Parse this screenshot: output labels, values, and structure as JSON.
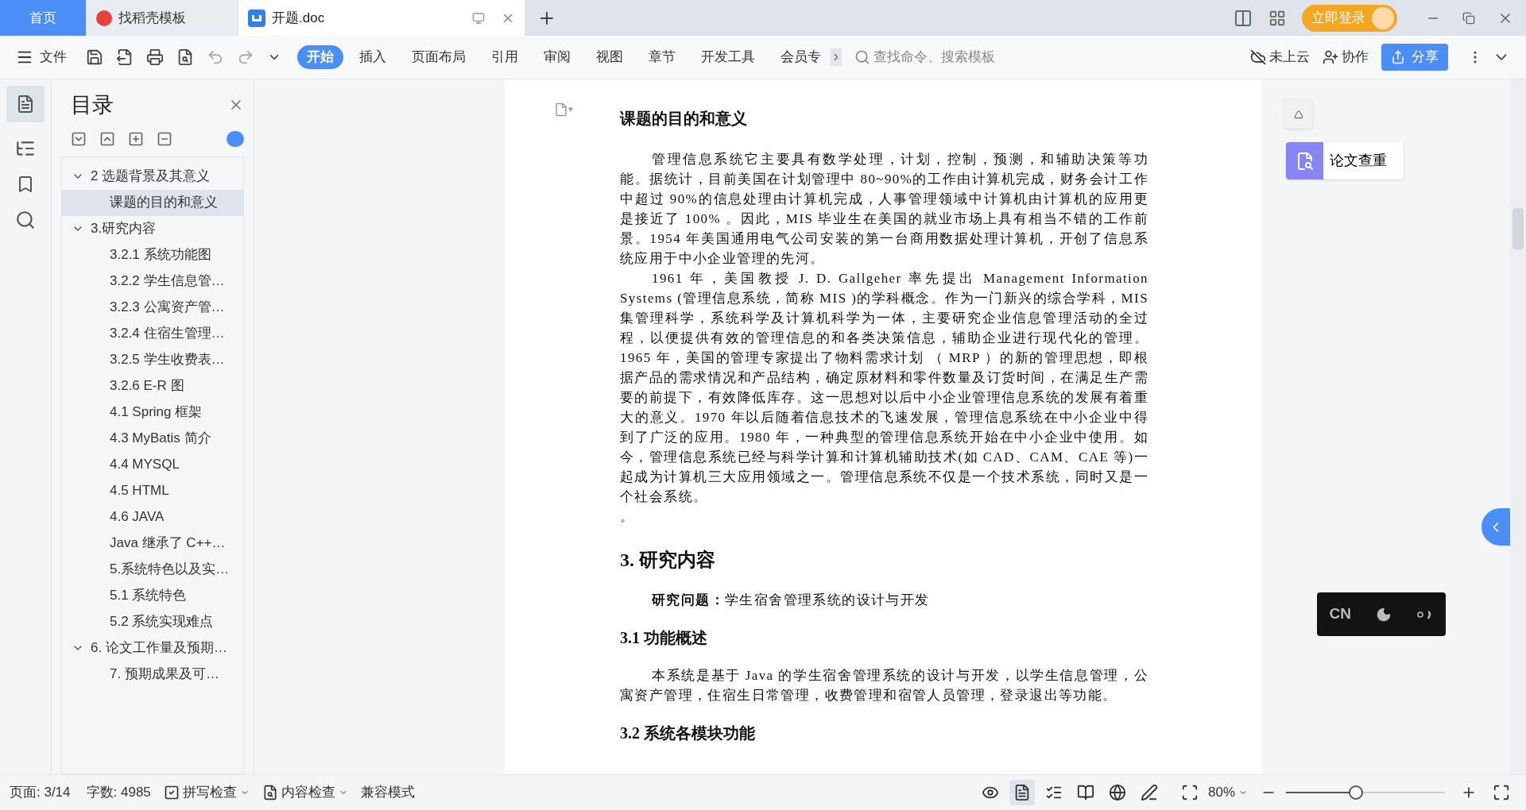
{
  "tabs": [
    {
      "label": "首页",
      "kind": "home",
      "selected": false
    },
    {
      "label": "找稻壳模板",
      "kind": "template",
      "selected": false
    },
    {
      "label": "开题.doc",
      "kind": "document",
      "selected": true
    }
  ],
  "login_button": "立即登录",
  "file_menu": "文件",
  "ribbon_tabs": [
    {
      "label": "开始",
      "selected": true
    },
    {
      "label": "插入",
      "selected": false
    },
    {
      "label": "页面布局",
      "selected": false
    },
    {
      "label": "引用",
      "selected": false
    },
    {
      "label": "审阅",
      "selected": false
    },
    {
      "label": "视图",
      "selected": false
    },
    {
      "label": "章节",
      "selected": false
    },
    {
      "label": "开发工具",
      "selected": false
    },
    {
      "label": "会员专",
      "selected": false
    }
  ],
  "search": {
    "placeholder": "查找命令、搜索模板"
  },
  "cloud_status": "未上云",
  "collaborate": "协作",
  "share": "分享",
  "toc": {
    "title": "目录",
    "items": [
      {
        "label": "2  选题背景及其意义",
        "expanded": true,
        "selected": false,
        "children": [
          {
            "label": "课题的目的和意义",
            "selected": true
          }
        ]
      },
      {
        "label": "3.研究内容",
        "expanded": true,
        "selected": false,
        "children": [
          {
            "label": "3.2.1 系统功能图",
            "selected": false
          },
          {
            "label": "3.2.2  学生信息管…",
            "selected": false
          },
          {
            "label": "3.2.3  公寓资产管…",
            "selected": false
          },
          {
            "label": "3.2.4 住宿生管理…",
            "selected": false
          },
          {
            "label": "3.2.5 学生收费表…",
            "selected": false
          },
          {
            "label": "3.2.6 E-R 图",
            "selected": false
          },
          {
            "label": "4.1 Spring 框架",
            "selected": false
          },
          {
            "label": "4.3 MyBatis 简介",
            "selected": false
          },
          {
            "label": "4.4 MYSQL",
            "selected": false
          },
          {
            "label": "4.5 HTML",
            "selected": false
          },
          {
            "label": "4.6 JAVA",
            "selected": false
          },
          {
            "label": "Java 继承了 C++…",
            "selected": false
          },
          {
            "label": "5.系统特色以及实…",
            "selected": false
          },
          {
            "label": "5.1  系统特色",
            "selected": false
          },
          {
            "label": "5.2  系统实现难点",
            "selected": false
          }
        ]
      },
      {
        "label": "6.  论文工作量及预期…",
        "expanded": true,
        "selected": false,
        "children": [
          {
            "label": "7.  预期成果及可…",
            "selected": false
          }
        ]
      }
    ]
  },
  "document": {
    "blocks": [
      {
        "kind": "section-title",
        "text": "课题的目的和意义"
      },
      {
        "kind": "body",
        "text": "管理信息系统它主要具有数学处理，计划，控制，预测，和辅助决策等功能。据统计，目前美国在计划管理中 80~90%的工作由计算机完成，财务会计工作中超过 90%的信息处理由计算机完成，人事管理领域中计算机由计算机的应用更是接近了 100% 。因此，MIS 毕业生在美国的就业市场上具有相当不错的工作前景。1954 年美国通用电气公司安装的第一台商用数据处理计算机，开创了信息系统应用于中小企业管理的先河。"
      },
      {
        "kind": "body",
        "text": "1961 年，美国教授 J. D. Gallgeher 率先提出 Management Information Systems (管理信息系统，简称 MIS )的学科概念。作为一门新兴的综合学科，MIS 集管理科学，系统科学及计算机科学为一体，主要研究企业信息管理活动的全过程，以便提供有效的管理信息的和各类决策信息，辅助企业进行现代化的管理。1965 年，美国的管理专家提出了物料需求计划 （ MRP ）的新的管理思想，即根据产品的需求情况和产品结构，确定原材料和零件数量及订货时间，在满足生产需要的前提下，有效降低库存。这一思想对以后中小企业管理信息系统的发展有着重大的意义。1970 年以后随着信息技术的飞速发展，管理信息系统在中小企业中得到了广泛的应用。1980 年，一种典型的管理信息系统开始在中小企业中使用。如今，管理信息系统已经与科学计算和计算机辅助技术(如 CAD、CAM、CAE 等)一起成为计算机三大应用领域之一。管理信息系统不仅是一个技术系统，同时又是一个社会系统。"
      },
      {
        "kind": "plain",
        "text": "。"
      },
      {
        "kind": "heading1",
        "text": "3. 研究内容"
      },
      {
        "kind": "body",
        "text": "**研究问题：**学生宿舍管理系统的设计与开发"
      },
      {
        "kind": "heading2",
        "text": "3.1  功能概述"
      },
      {
        "kind": "body",
        "text": "本系统是基于 Java 的学生宿舍管理系统的设计与开发，以学生信息管理，公寓资产管理，住宿生日常管理，收费管理和宿管人员管理，登录退出等功能。"
      },
      {
        "kind": "heading2",
        "text": "3.2 系统各模块功能"
      }
    ]
  },
  "side_tool": {
    "label": "论文查重"
  },
  "ime": {
    "mode": "CN"
  },
  "status_bar": {
    "page": "页面: 3/14",
    "words": "字数: 4985",
    "spell_check": "拼写检查",
    "content_check": "内容检查",
    "compat": "兼容模式",
    "views": [
      {
        "kind": "read",
        "selected": false
      },
      {
        "kind": "page",
        "selected": true
      },
      {
        "kind": "outline",
        "selected": false
      },
      {
        "kind": "book",
        "selected": false
      },
      {
        "kind": "web",
        "selected": false
      },
      {
        "kind": "write",
        "selected": false
      }
    ],
    "zoom": "80%",
    "zoom_slider": {
      "level": 0.44
    }
  }
}
